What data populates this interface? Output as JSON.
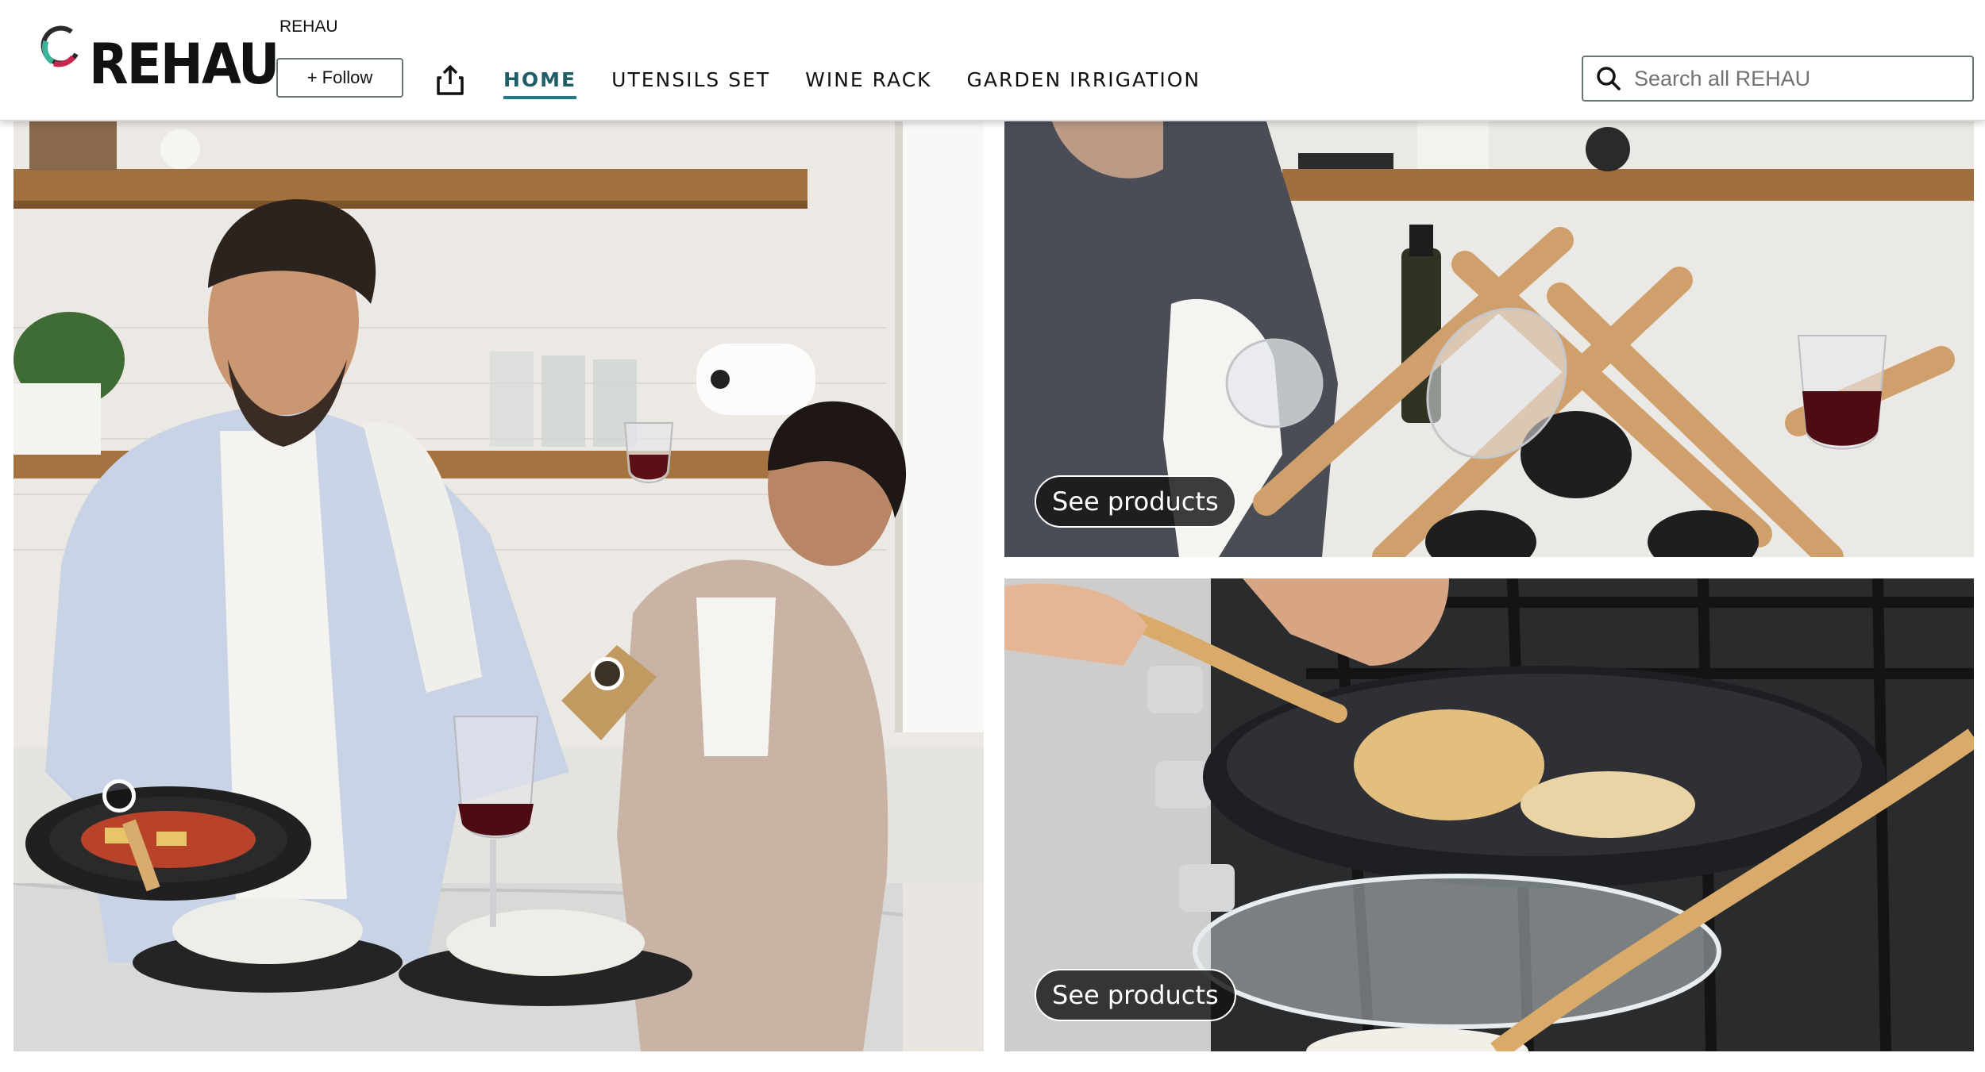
{
  "header": {
    "brand_caption": "REHAU",
    "logo_text": "REHAU",
    "follow_label": "+ Follow",
    "share_icon": "share-icon",
    "nav": [
      {
        "label": "HOME",
        "active": true
      },
      {
        "label": "UTENSILS SET",
        "active": false
      },
      {
        "label": "WINE RACK",
        "active": false
      },
      {
        "label": "GARDEN IRRIGATION",
        "active": false
      }
    ],
    "search": {
      "placeholder": "Search all REHAU",
      "value": "",
      "icon": "search-icon"
    }
  },
  "tiles": {
    "main": {
      "image": "man cooking pasta in frying pan with woman holding wine glass in kitchen",
      "hotspots": 2
    },
    "top_right": {
      "image": "woman drying wine glass next to bamboo wine rack",
      "button": "See products"
    },
    "bottom_right": {
      "image": "flipping pancakes in speckled frying pan with bamboo spatula on gas stove",
      "button": "See products"
    }
  },
  "colors": {
    "active_nav": "#1f5e68",
    "active_underline": "#1f7a86",
    "button_bg": "#141414"
  }
}
